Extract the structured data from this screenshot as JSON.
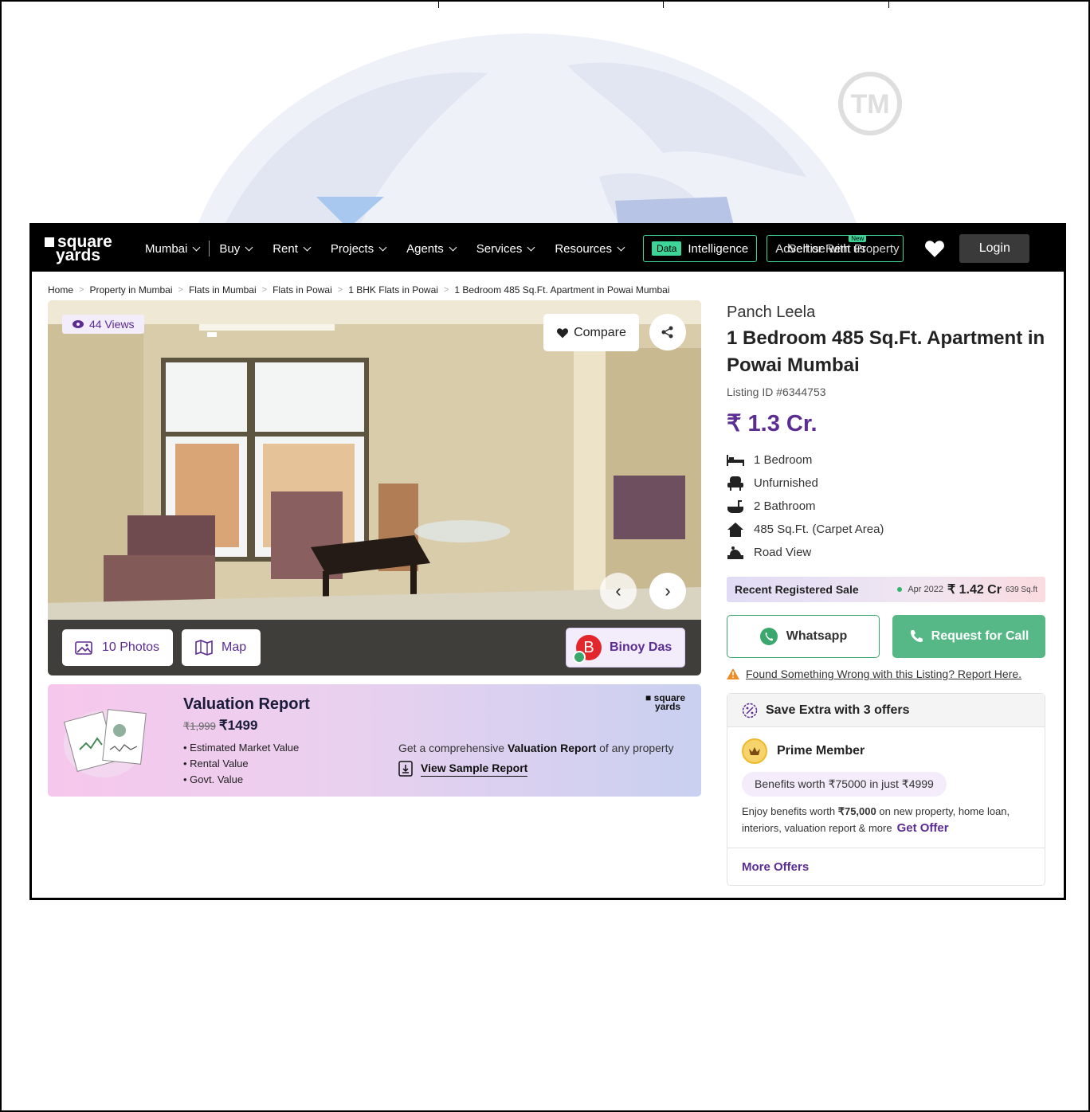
{
  "nav": {
    "logo_line1": "square",
    "logo_line2": "yards",
    "city": "Mumbai",
    "items": [
      {
        "label": "Buy"
      },
      {
        "label": "Rent"
      },
      {
        "label": "Projects"
      },
      {
        "label": "Agents"
      },
      {
        "label": "Services"
      },
      {
        "label": "Resources"
      }
    ],
    "data_tag": "Data",
    "data_label": "Intelligence",
    "sell_label": "Advertise with us",
    "sell_overlay": "Sell or Rent Property",
    "new_tag": "New",
    "login": "Login"
  },
  "breadcrumbs": [
    "Home",
    "Property in Mumbai",
    "Flats in Mumbai",
    "Flats in Powai",
    "1 BHK Flats in Powai",
    "1 Bedroom 485 Sq.Ft. Apartment in Powai Mumbai"
  ],
  "gallery": {
    "views": "44 Views",
    "compare": "Compare",
    "photos": "10 Photos",
    "map": "Map",
    "agent_initial": "B",
    "agent_name": "Binoy Das"
  },
  "valuation": {
    "title": "Valuation Report",
    "old_price": "₹1,999",
    "price": "₹1499",
    "points": [
      "Estimated Market Value",
      "Rental Value",
      "Govt. Value"
    ],
    "desc_pre": "Get a comprehensive ",
    "desc_bold": "Valuation Report",
    "desc_post": " of any property",
    "link": "View Sample Report",
    "logo_line1": "square",
    "logo_line2": "yards"
  },
  "listing": {
    "project": "Panch Leela",
    "title": "1 Bedroom 485 Sq.Ft. Apartment in Powai Mumbai",
    "listing_id": "Listing ID #6344753",
    "price": "₹ 1.3 Cr.",
    "features": [
      {
        "icon": "bed-icon",
        "label": "1 Bedroom"
      },
      {
        "icon": "sofa-icon",
        "label": "Unfurnished"
      },
      {
        "icon": "bathtub-icon",
        "label": "2 Bathroom"
      },
      {
        "icon": "home-icon",
        "label": "485 Sq.Ft. (Carpet Area)"
      },
      {
        "icon": "view-icon",
        "label": "Road View"
      }
    ],
    "recent_sale": {
      "label": "Recent Registered Sale",
      "date": "Apr 2022",
      "amount": "₹ 1.42 Cr",
      "sqft": "639 Sq.ft"
    },
    "whatsapp": "Whatsapp",
    "call": "Request for Call",
    "report": "Found Something Wrong with this Listing? Report Here."
  },
  "offers": {
    "head": "Save Extra with 3 offers",
    "prime_title": "Prime Member",
    "pill": "Benefits worth ₹75000 in just ₹4999",
    "desc_pre": "Enjoy benefits worth ",
    "desc_bold": "₹75,000",
    "desc_post": " on new property, home loan, interiors, valuation report & more",
    "get_offer": "Get Offer",
    "more": "More Offers"
  },
  "colors": {
    "brand_purple": "#5b2c91",
    "accent_green": "#3dd598",
    "call_green": "#56b886",
    "whatsapp_green": "#3aa76d"
  }
}
